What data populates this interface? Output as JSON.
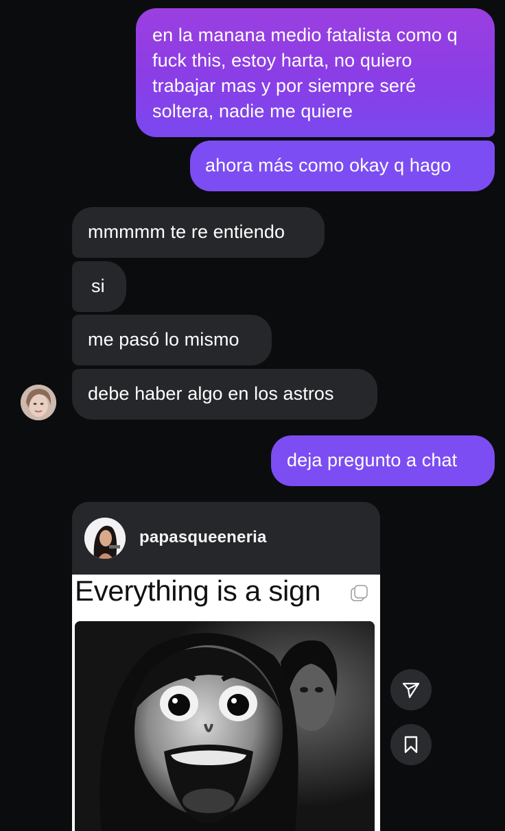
{
  "conversation": {
    "messages": [
      {
        "direction": "outgoing",
        "text": "en la manana medio fatalista como q fuck this, estoy harta, no quiero trabajar mas y por siempre seré soltera, nadie me quiere"
      },
      {
        "direction": "outgoing",
        "text": "ahora más como okay q hago"
      },
      {
        "direction": "incoming",
        "text": "mmmmm te re entiendo"
      },
      {
        "direction": "incoming",
        "text": "si"
      },
      {
        "direction": "incoming",
        "text": "me pasó lo mismo"
      },
      {
        "direction": "incoming",
        "text": "debe haber algo en los astros"
      },
      {
        "direction": "outgoing",
        "text": "deja pregunto a chat"
      }
    ]
  },
  "shared_post": {
    "username": "papasqueeneria",
    "caption": "Everything is a sign"
  },
  "actions": {
    "share_icon": "paper-plane-icon",
    "save_icon": "bookmark-icon"
  },
  "colors": {
    "background": "#0b0c0e",
    "incoming_bubble": "#26272b",
    "outgoing_gradient_top": "#9b3fe0",
    "outgoing_gradient_bottom": "#7a48f0"
  }
}
